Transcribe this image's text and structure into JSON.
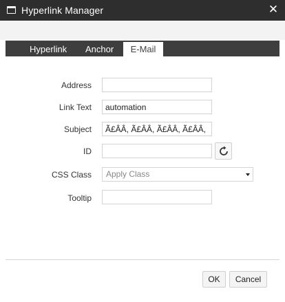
{
  "window": {
    "title": "Hyperlink Manager",
    "close_glyph": "✕"
  },
  "tabs": [
    {
      "label": "Hyperlink",
      "active": false
    },
    {
      "label": "Anchor",
      "active": false
    },
    {
      "label": "E-Mail",
      "active": true
    }
  ],
  "form": {
    "address": {
      "label": "Address",
      "value": ""
    },
    "link_text": {
      "label": "Link Text",
      "value": "automation"
    },
    "subject": {
      "label": "Subject",
      "value": "Ã£ÂÂ, Ã£ÂÂ, Ã£ÂÂ, Ã£ÂÂ,"
    },
    "id": {
      "label": "ID",
      "value": ""
    },
    "css_class": {
      "label": "CSS Class",
      "selected": "Apply Class"
    },
    "tooltip": {
      "label": "Tooltip",
      "value": ""
    }
  },
  "footer": {
    "ok_label": "OK",
    "cancel_label": "Cancel"
  },
  "colors": {
    "titlebar": "#2e2e2e",
    "tabbar": "#3e3e3e",
    "active_tab": "#ffffff"
  }
}
